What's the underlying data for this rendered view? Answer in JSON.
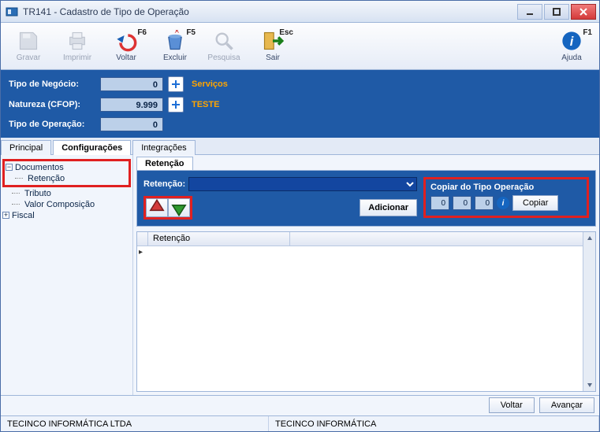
{
  "window": {
    "title": "TR141 - Cadastro de Tipo de Operação"
  },
  "toolbar": {
    "gravar": "Gravar",
    "imprimir": "Imprimir",
    "voltar": "Voltar",
    "voltar_sc": "F6",
    "excluir": "Excluir",
    "excluir_sc": "F5",
    "pesquisa": "Pesquisa",
    "sair": "Sair",
    "sair_sc": "Esc",
    "ajuda": "Ajuda",
    "ajuda_sc": "F1"
  },
  "top": {
    "tipoNegocio": {
      "label": "Tipo de Negócio:",
      "value": "0",
      "desc": "Serviços"
    },
    "natureza": {
      "label": "Natureza (CFOP):",
      "value": "9.999",
      "desc": "TESTE"
    },
    "tipoOperacao": {
      "label": "Tipo de Operação:",
      "value": "0"
    }
  },
  "tabs": {
    "principal": "Principal",
    "config": "Configurações",
    "integra": "Integrações"
  },
  "tree": {
    "documentos": "Documentos",
    "retencao": "Retenção",
    "tributo": "Tributo",
    "valorComp": "Valor Composição",
    "fiscal": "Fiscal"
  },
  "subtab": {
    "retencao": "Retenção"
  },
  "form": {
    "retencaoLabel": "Retenção:",
    "adicionar": "Adicionar",
    "copiarGroup": "Copiar do Tipo Operação",
    "v1": "0",
    "v2": "0",
    "v3": "0",
    "copiarBtn": "Copiar"
  },
  "grid": {
    "col1": "Retenção"
  },
  "bottom": {
    "voltar": "Voltar",
    "avancar": "Avançar"
  },
  "status": {
    "c1": "TECINCO INFORMÁTICA LTDA",
    "c2": "TECINCO INFORMÁTICA"
  }
}
